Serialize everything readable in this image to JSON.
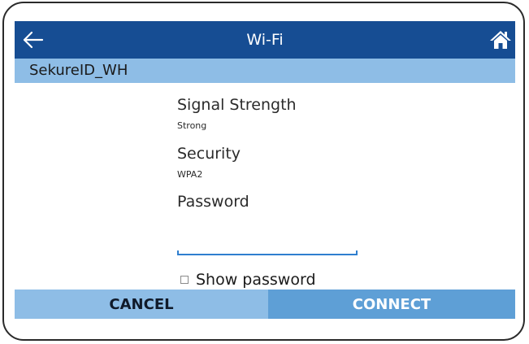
{
  "header": {
    "title": "Wi-Fi",
    "back_icon": "arrow-left-icon",
    "home_icon": "home-icon",
    "bar_color": "#164d93"
  },
  "network": {
    "name": "SekureID_WH",
    "bar_color": "#8ebde6"
  },
  "details": {
    "signal_label": "Signal Strength",
    "signal_value": "Strong",
    "security_label": "Security",
    "security_value": "WPA2",
    "password_label": "Password"
  },
  "password_field": {
    "value": ""
  },
  "show_password": {
    "label": "Show password",
    "checked": false
  },
  "actions": {
    "cancel_label": "CANCEL",
    "connect_label": "CONNECT",
    "cancel_color": "#8ebde6",
    "connect_color": "#5e9fd6"
  }
}
